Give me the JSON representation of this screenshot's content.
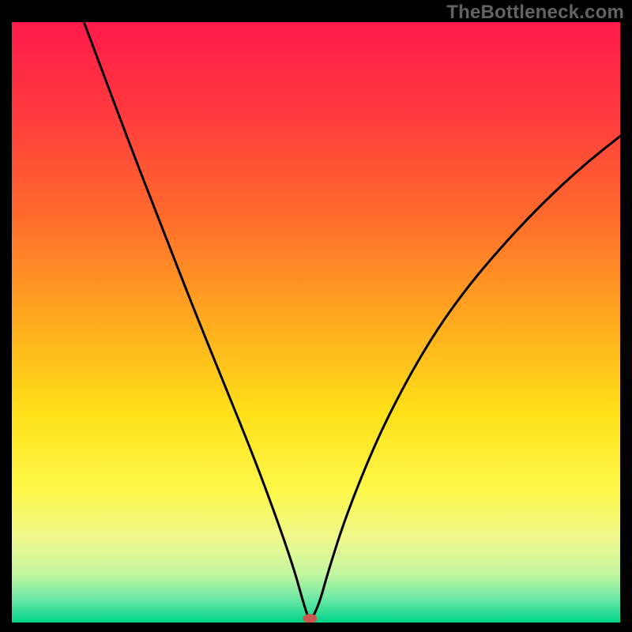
{
  "watermark": "TheBottleneck.com",
  "chart_data": {
    "type": "line",
    "title": "",
    "xlabel": "",
    "ylabel": "",
    "xlim": [
      0,
      100
    ],
    "ylim": [
      0,
      100
    ],
    "background_gradient": {
      "stops": [
        {
          "offset": 0.0,
          "color": "#ff1a4b"
        },
        {
          "offset": 0.15,
          "color": "#ff3a3f"
        },
        {
          "offset": 0.32,
          "color": "#ff6a2c"
        },
        {
          "offset": 0.5,
          "color": "#ffab1f"
        },
        {
          "offset": 0.65,
          "color": "#ffe019"
        },
        {
          "offset": 0.78,
          "color": "#fdf84a"
        },
        {
          "offset": 0.86,
          "color": "#eff88e"
        },
        {
          "offset": 0.92,
          "color": "#c3f6a0"
        },
        {
          "offset": 0.965,
          "color": "#62e6a4"
        },
        {
          "offset": 1.0,
          "color": "#00d588"
        }
      ]
    },
    "marker": {
      "x": 49,
      "y": 0,
      "color": "#c6584e"
    },
    "series": [
      {
        "name": "curve",
        "color": "#000000",
        "x": [
          0,
          5,
          10,
          15,
          20,
          25,
          30,
          35,
          40,
          44,
          46.5,
          48,
          49,
          50.5,
          52,
          55,
          60,
          65,
          70,
          75,
          80,
          85,
          90,
          95,
          100
        ],
        "y": [
          133,
          119,
          105,
          91.5,
          78,
          65,
          52,
          39.5,
          27,
          16,
          8.5,
          3,
          0,
          3,
          8.5,
          18,
          30.5,
          40.5,
          49,
          56,
          62,
          67.5,
          72.5,
          77,
          81
        ]
      }
    ]
  }
}
